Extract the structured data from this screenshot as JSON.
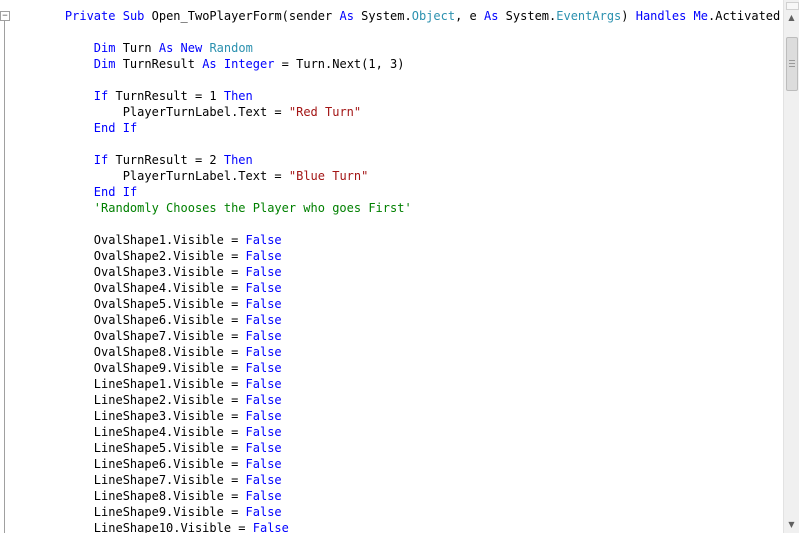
{
  "editor": {
    "collapse_glyph": "−",
    "lines": [
      [
        [
          "    ",
          "plain"
        ],
        [
          "Private",
          "keyword"
        ],
        [
          " ",
          "plain"
        ],
        [
          "Sub",
          "keyword"
        ],
        [
          " Open_TwoPlayerForm(sender ",
          "plain"
        ],
        [
          "As",
          "keyword"
        ],
        [
          " System.",
          "plain"
        ],
        [
          "Object",
          "type"
        ],
        [
          ", e ",
          "plain"
        ],
        [
          "As",
          "keyword"
        ],
        [
          " System.",
          "plain"
        ],
        [
          "EventArgs",
          "type"
        ],
        [
          ") ",
          "plain"
        ],
        [
          "Handles",
          "keyword"
        ],
        [
          " ",
          "plain"
        ],
        [
          "Me",
          "keyword"
        ],
        [
          ".Activated",
          "plain"
        ]
      ],
      [],
      [
        [
          "        ",
          "plain"
        ],
        [
          "Dim",
          "keyword"
        ],
        [
          " Turn ",
          "plain"
        ],
        [
          "As",
          "keyword"
        ],
        [
          " ",
          "plain"
        ],
        [
          "New",
          "keyword"
        ],
        [
          " ",
          "plain"
        ],
        [
          "Random",
          "type"
        ]
      ],
      [
        [
          "        ",
          "plain"
        ],
        [
          "Dim",
          "keyword"
        ],
        [
          " TurnResult ",
          "plain"
        ],
        [
          "As",
          "keyword"
        ],
        [
          " ",
          "plain"
        ],
        [
          "Integer",
          "keyword"
        ],
        [
          " = Turn.Next(1, 3)",
          "plain"
        ]
      ],
      [],
      [
        [
          "        ",
          "plain"
        ],
        [
          "If",
          "keyword"
        ],
        [
          " TurnResult = 1 ",
          "plain"
        ],
        [
          "Then",
          "keyword"
        ]
      ],
      [
        [
          "            PlayerTurnLabel.Text = ",
          "plain"
        ],
        [
          "\"Red Turn\"",
          "string"
        ]
      ],
      [
        [
          "        ",
          "plain"
        ],
        [
          "End",
          "keyword"
        ],
        [
          " ",
          "plain"
        ],
        [
          "If",
          "keyword"
        ]
      ],
      [],
      [
        [
          "        ",
          "plain"
        ],
        [
          "If",
          "keyword"
        ],
        [
          " TurnResult = 2 ",
          "plain"
        ],
        [
          "Then",
          "keyword"
        ]
      ],
      [
        [
          "            PlayerTurnLabel.Text = ",
          "plain"
        ],
        [
          "\"Blue Turn\"",
          "string"
        ]
      ],
      [
        [
          "        ",
          "plain"
        ],
        [
          "End",
          "keyword"
        ],
        [
          " ",
          "plain"
        ],
        [
          "If",
          "keyword"
        ]
      ],
      [
        [
          "        ",
          "plain"
        ],
        [
          "'Randomly Chooses the Player who goes First'",
          "comment"
        ]
      ],
      [],
      [
        [
          "        OvalShape1.Visible = ",
          "plain"
        ],
        [
          "False",
          "keyword"
        ]
      ],
      [
        [
          "        OvalShape2.Visible = ",
          "plain"
        ],
        [
          "False",
          "keyword"
        ]
      ],
      [
        [
          "        OvalShape3.Visible = ",
          "plain"
        ],
        [
          "False",
          "keyword"
        ]
      ],
      [
        [
          "        OvalShape4.Visible = ",
          "plain"
        ],
        [
          "False",
          "keyword"
        ]
      ],
      [
        [
          "        OvalShape5.Visible = ",
          "plain"
        ],
        [
          "False",
          "keyword"
        ]
      ],
      [
        [
          "        OvalShape6.Visible = ",
          "plain"
        ],
        [
          "False",
          "keyword"
        ]
      ],
      [
        [
          "        OvalShape7.Visible = ",
          "plain"
        ],
        [
          "False",
          "keyword"
        ]
      ],
      [
        [
          "        OvalShape8.Visible = ",
          "plain"
        ],
        [
          "False",
          "keyword"
        ]
      ],
      [
        [
          "        OvalShape9.Visible = ",
          "plain"
        ],
        [
          "False",
          "keyword"
        ]
      ],
      [
        [
          "        LineShape1.Visible = ",
          "plain"
        ],
        [
          "False",
          "keyword"
        ]
      ],
      [
        [
          "        LineShape2.Visible = ",
          "plain"
        ],
        [
          "False",
          "keyword"
        ]
      ],
      [
        [
          "        LineShape3.Visible = ",
          "plain"
        ],
        [
          "False",
          "keyword"
        ]
      ],
      [
        [
          "        LineShape4.Visible = ",
          "plain"
        ],
        [
          "False",
          "keyword"
        ]
      ],
      [
        [
          "        LineShape5.Visible = ",
          "plain"
        ],
        [
          "False",
          "keyword"
        ]
      ],
      [
        [
          "        LineShape6.Visible = ",
          "plain"
        ],
        [
          "False",
          "keyword"
        ]
      ],
      [
        [
          "        LineShape7.Visible = ",
          "plain"
        ],
        [
          "False",
          "keyword"
        ]
      ],
      [
        [
          "        LineShape8.Visible = ",
          "plain"
        ],
        [
          "False",
          "keyword"
        ]
      ],
      [
        [
          "        LineShape9.Visible = ",
          "plain"
        ],
        [
          "False",
          "keyword"
        ]
      ],
      [
        [
          "        LineShape10.Visible = ",
          "plain"
        ],
        [
          "False",
          "keyword"
        ]
      ]
    ]
  },
  "scrollbar": {
    "up_glyph": "▲",
    "down_glyph": "▼",
    "position_fraction": 0.02
  },
  "colors": {
    "keyword": "#0000ff",
    "type": "#2b91af",
    "string": "#a31515",
    "comment": "#008000",
    "plain": "#000000",
    "background": "#ffffff"
  },
  "icons": {
    "collapse": "minus-square-icon",
    "scroll_up": "arrow-up-icon",
    "scroll_down": "arrow-down-icon"
  }
}
